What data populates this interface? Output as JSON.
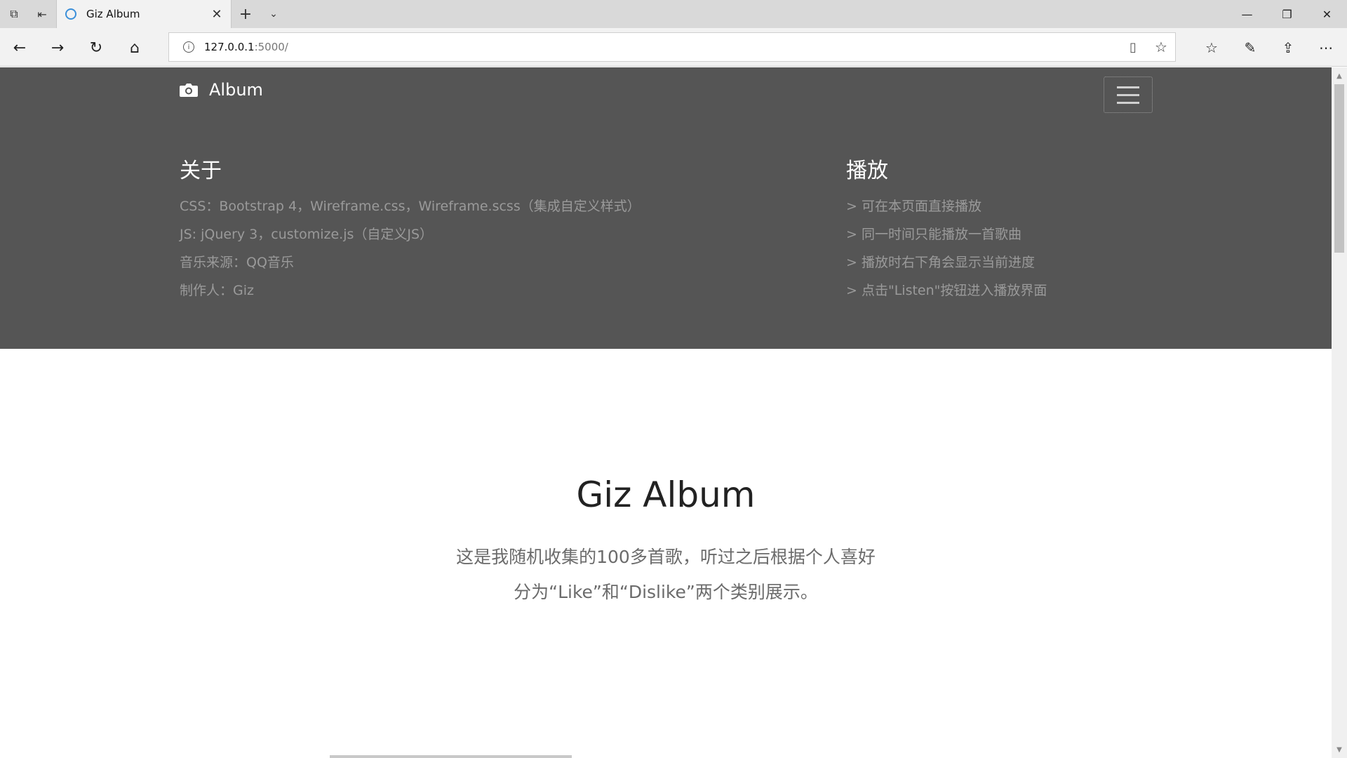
{
  "browser": {
    "tab_title": "Giz Album",
    "url_host": "127.0.0.1",
    "url_path": ":5000/"
  },
  "navbar": {
    "brand": "Album"
  },
  "about": {
    "heading": "关于",
    "lines": [
      "CSS：Bootstrap 4，Wireframe.css，Wireframe.scss（集成自定义样式）",
      "JS: jQuery 3，customize.js（自定义JS）",
      "音乐来源：QQ音乐",
      "制作人：Giz"
    ]
  },
  "play": {
    "heading": "播放",
    "lines": [
      "> 可在本页面直接播放",
      "> 同一时间只能播放一首歌曲",
      "> 播放时右下角会显示当前进度",
      "> 点击\"Listen\"按钮进入播放界面"
    ]
  },
  "jumbotron": {
    "title": "Giz Album",
    "lead_line1": "这是我随机收集的100多首歌，听过之后根据个人喜好",
    "lead_line2": "分为“Like”和“Dislike”两个类别展示。"
  }
}
